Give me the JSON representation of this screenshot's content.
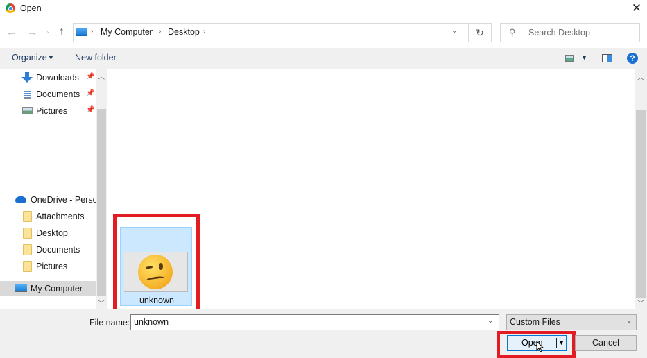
{
  "window": {
    "title": "Open",
    "close_glyph": "✕"
  },
  "nav": {
    "back_glyph": "←",
    "forward_glyph": "→",
    "recent_glyph": "⌄",
    "up_glyph": "↑"
  },
  "address": {
    "breadcrumbs": [
      "My Computer",
      "Desktop"
    ],
    "sep_glyph": "›",
    "dropdown_glyph": "⌄",
    "refresh_glyph": "↻"
  },
  "search": {
    "placeholder": "Search Desktop",
    "icon_glyph": "⚲"
  },
  "toolbar": {
    "organize_label": "Organize",
    "new_folder_label": "New folder",
    "caret_glyph": "▼",
    "help_glyph": "?"
  },
  "sidebar": {
    "items": [
      {
        "label": "Downloads",
        "icon": "download-icon",
        "pinned": true
      },
      {
        "label": "Documents",
        "icon": "documents-icon",
        "pinned": true
      },
      {
        "label": "Pictures",
        "icon": "pictures-icon",
        "pinned": true
      },
      {
        "label": "OneDrive - Persor",
        "icon": "onedrive-icon",
        "pinned": false
      },
      {
        "label": "Attachments",
        "icon": "folder-icon",
        "pinned": false
      },
      {
        "label": "Desktop",
        "icon": "folder-icon",
        "pinned": false
      },
      {
        "label": "Documents",
        "icon": "folder-icon",
        "pinned": false
      },
      {
        "label": "Pictures",
        "icon": "folder-icon",
        "pinned": false
      },
      {
        "label": "My Computer",
        "icon": "computer-icon",
        "pinned": false,
        "selected": true
      }
    ],
    "pin_glyph": "📌",
    "scroll_up_glyph": "︿",
    "scroll_down_glyph": "﹀"
  },
  "files": [
    {
      "name": "unknown",
      "type": "image",
      "selected": true
    }
  ],
  "footer": {
    "file_name_label": "File name:",
    "file_name_value": "unknown",
    "file_type_value": "Custom Files",
    "dropdown_glyph": "⌄",
    "open_label": "Open",
    "open_caret_glyph": "▼",
    "cancel_label": "Cancel"
  },
  "colors": {
    "highlight": "#e31b23",
    "selection": "#cce8ff",
    "accent": "#0078d7"
  }
}
